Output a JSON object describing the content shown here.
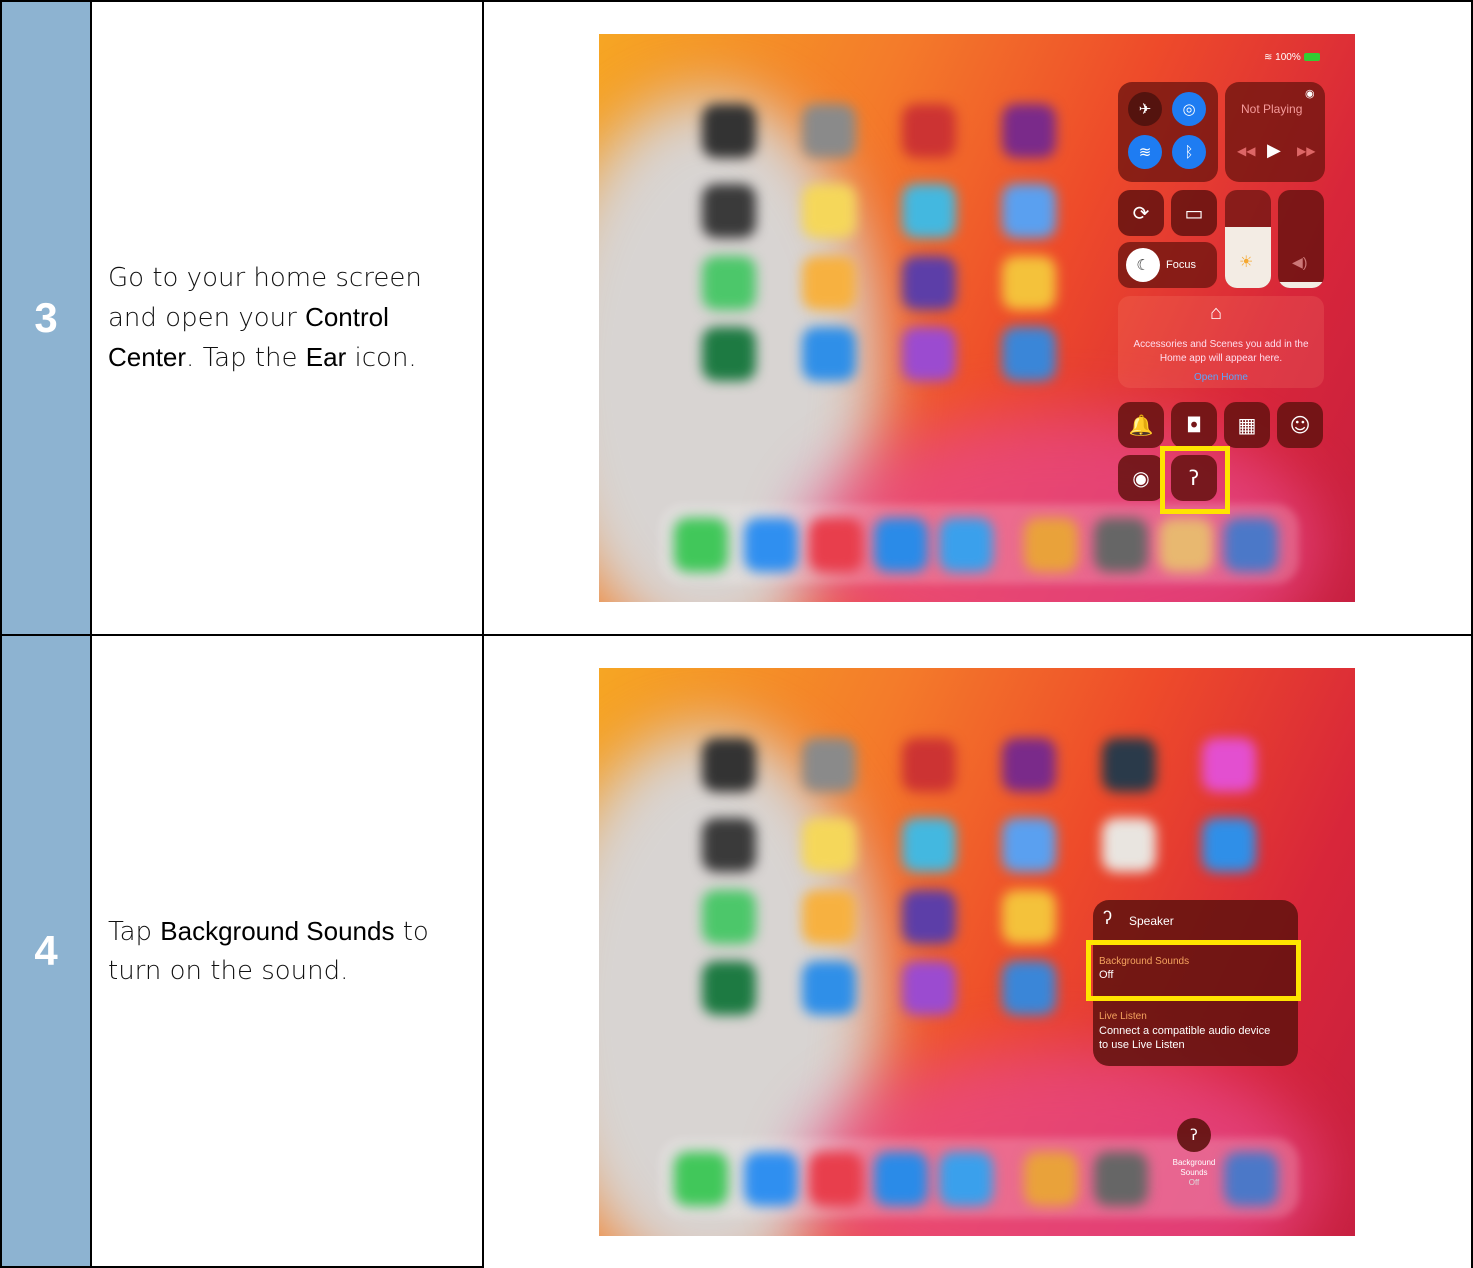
{
  "rows": [
    {
      "step": "3",
      "text_parts": [
        "Go to your home screen and open your ",
        "Control Center",
        ". Tap the ",
        "Ear",
        " icon."
      ],
      "screenshot": {
        "status": "100%",
        "now_playing": "Not Playing",
        "focus": "Focus",
        "home_text": "Accessories and Scenes you add in the Home app will appear here.",
        "open_home": "Open Home"
      }
    },
    {
      "step": "4",
      "text_parts": [
        "Tap ",
        "Background Sounds",
        " to turn on the sound."
      ],
      "screenshot": {
        "speaker": "Speaker",
        "bg_label": "Background Sounds",
        "bg_state": "Off",
        "live_label": "Live Listen",
        "live_desc": "Connect a compatible audio device to use Live Listen",
        "bottom_label_1": "Background",
        "bottom_label_2": "Sounds",
        "bottom_state": "Off"
      }
    }
  ],
  "colors": {
    "step_bg": "#8db3d1",
    "highlight": "#ffe400"
  }
}
